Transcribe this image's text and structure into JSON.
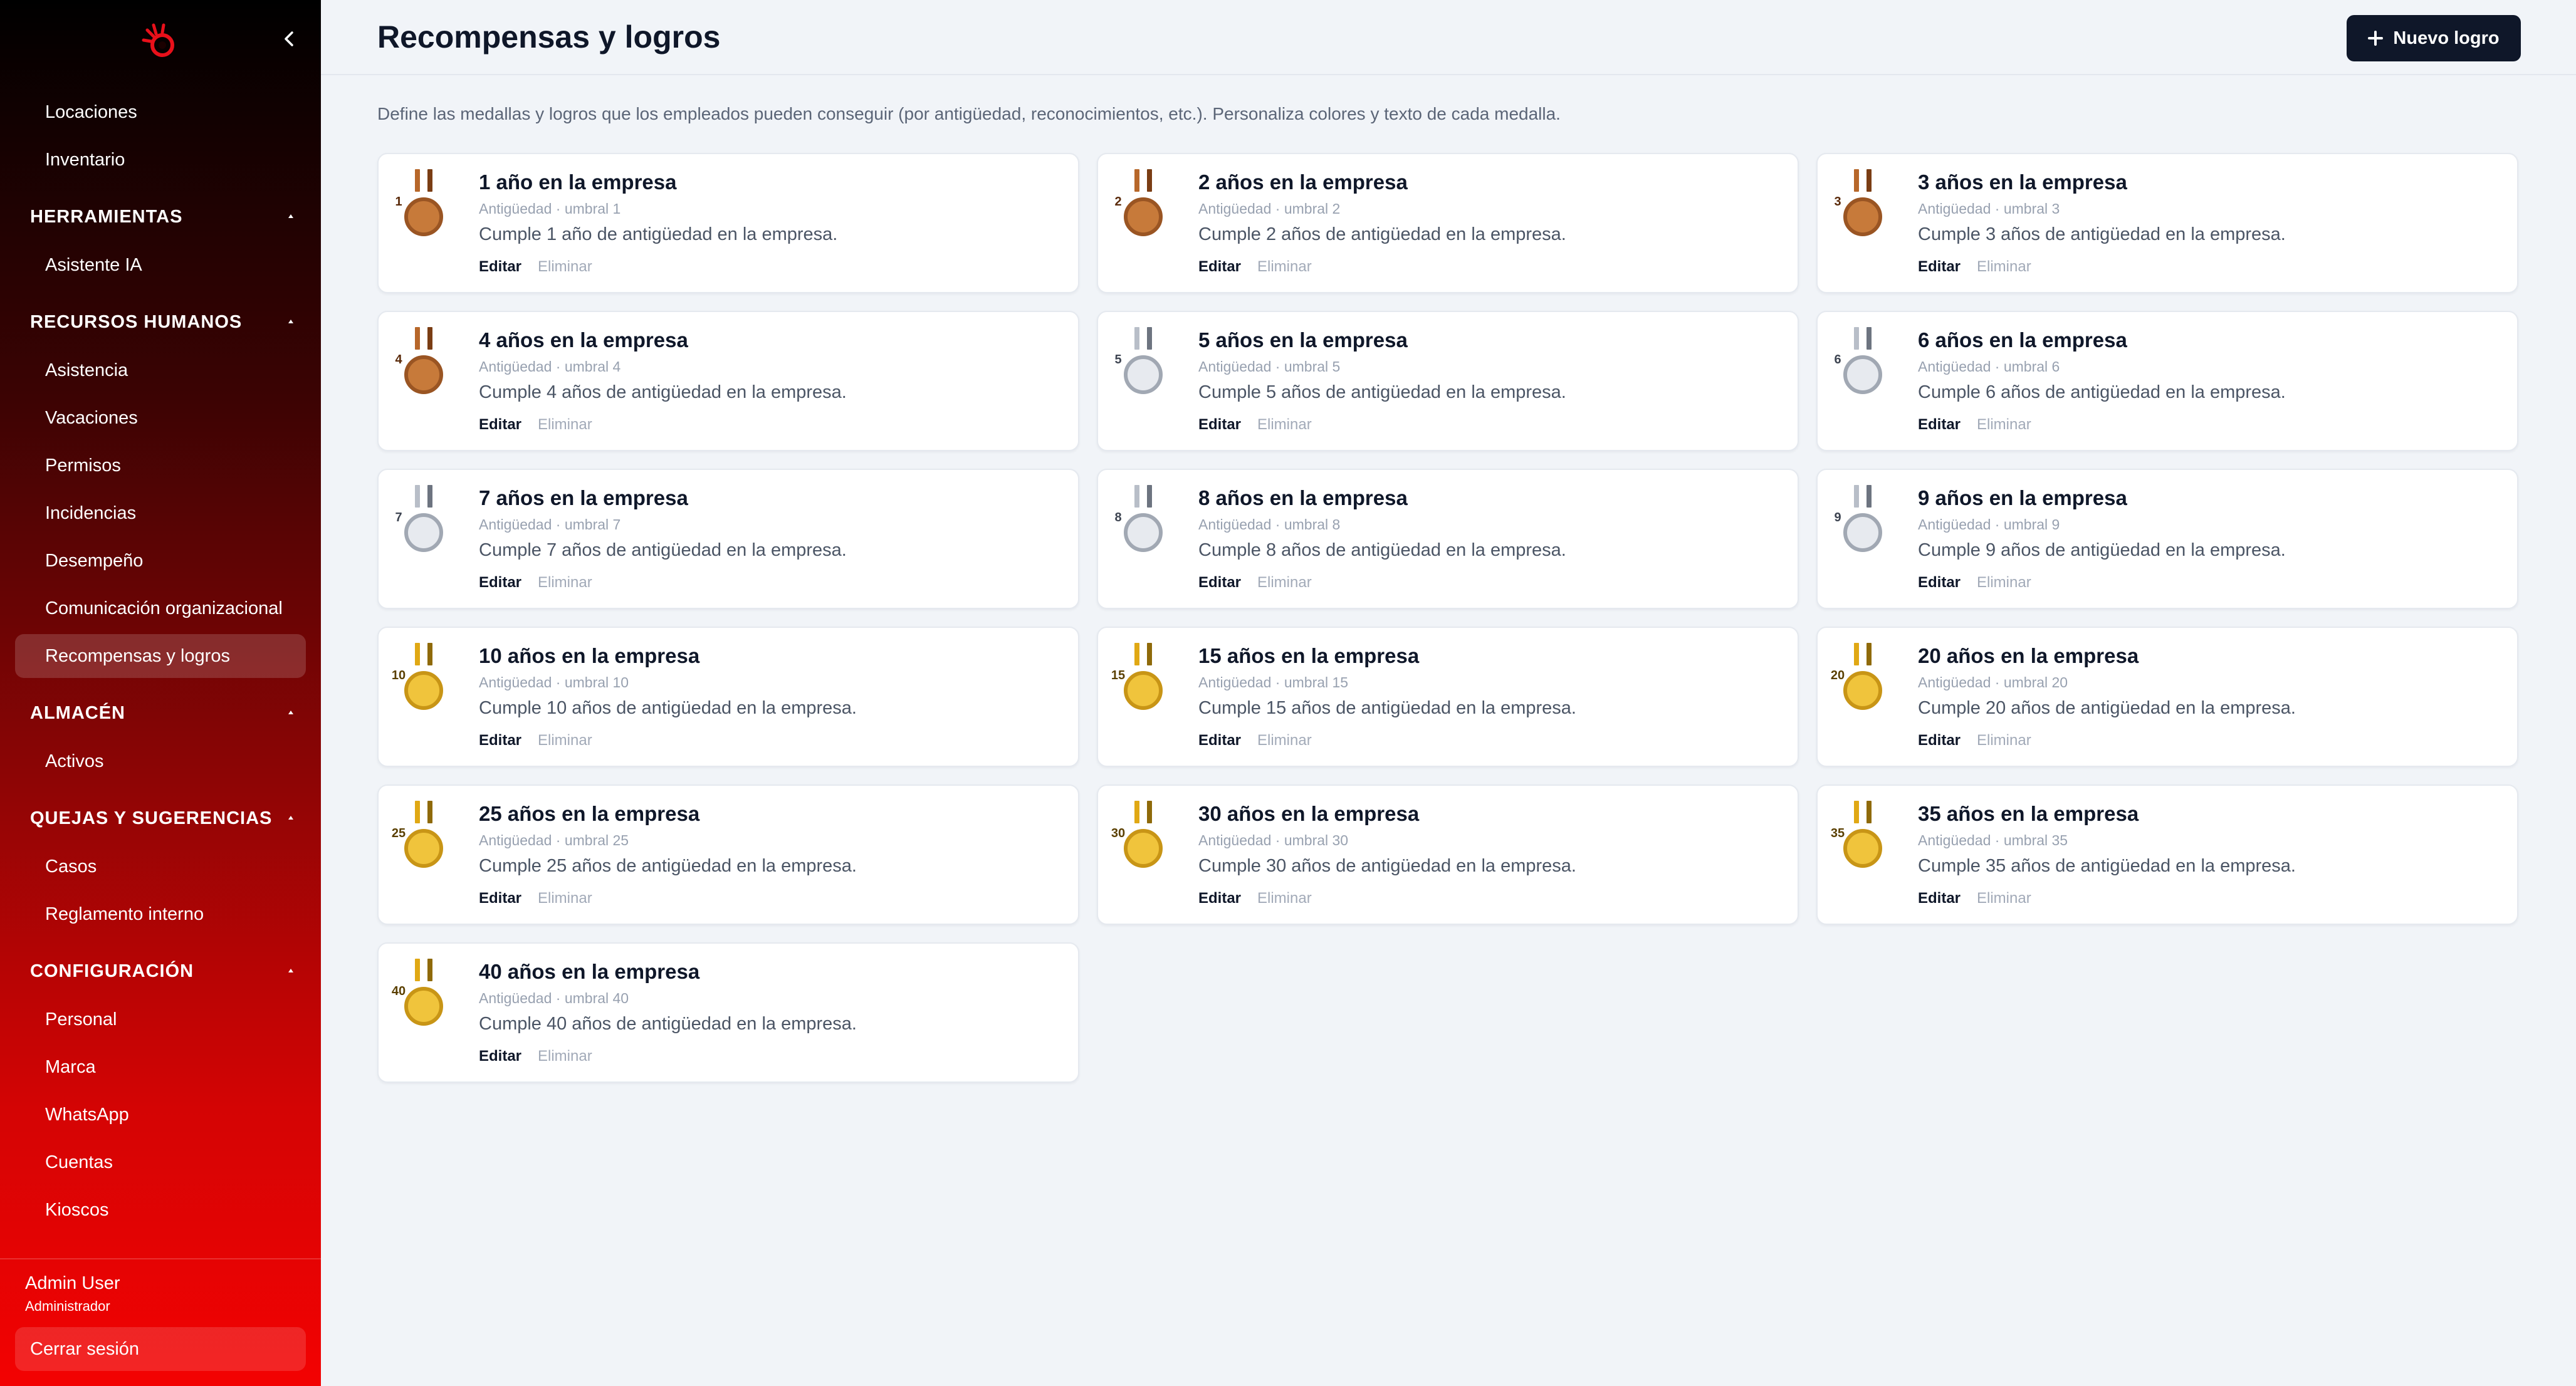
{
  "sidebar": {
    "items_top": [
      {
        "label": "Locaciones"
      },
      {
        "label": "Inventario"
      }
    ],
    "sections": [
      {
        "title": "HERRAMIENTAS",
        "items": [
          {
            "label": "Asistente IA"
          }
        ]
      },
      {
        "title": "RECURSOS HUMANOS",
        "items": [
          {
            "label": "Asistencia"
          },
          {
            "label": "Vacaciones"
          },
          {
            "label": "Permisos"
          },
          {
            "label": "Incidencias"
          },
          {
            "label": "Desempeño"
          },
          {
            "label": "Comunicación organizacional"
          },
          {
            "label": "Recompensas y logros"
          }
        ]
      },
      {
        "title": "ALMACÉN",
        "items": [
          {
            "label": "Activos"
          }
        ]
      },
      {
        "title": "QUEJAS Y SUGERENCIAS",
        "items": [
          {
            "label": "Casos"
          },
          {
            "label": "Reglamento interno"
          }
        ]
      },
      {
        "title": "CONFIGURACIÓN",
        "items": [
          {
            "label": "Personal"
          },
          {
            "label": "Marca"
          },
          {
            "label": "WhatsApp"
          },
          {
            "label": "Cuentas"
          },
          {
            "label": "Kioscos"
          }
        ]
      }
    ],
    "active_item": "Recompensas y logros",
    "user": {
      "name": "Admin User",
      "role": "Administrador"
    },
    "logout_label": "Cerrar sesión",
    "logo_icon": "brand-logo-icon",
    "collapse_icon": "chevron-left-icon"
  },
  "header": {
    "title": "Recompensas y logros",
    "new_button_label": "Nuevo logro",
    "new_button_icon": "plus-icon"
  },
  "subtitle": "Define las medallas y logros que los empleados pueden conseguir (por antigüedad, reconocimientos, etc.). Personaliza colores y texto de cada medalla.",
  "colors": {
    "primary": "#0f1729",
    "sidebar_top": "#000000",
    "sidebar_bottom": "#f30202",
    "bronze": "#c77a3a",
    "silver": "#d5d9df",
    "gold": "#f0c43c"
  },
  "achievements": [
    {
      "number": "1",
      "tier": "bronze",
      "title": "1 año en la empresa",
      "meta": "Antigüedad · umbral 1",
      "description": "Cumple 1 año de antigüedad en la empresa.",
      "edit": "Editar",
      "delete": "Eliminar"
    },
    {
      "number": "2",
      "tier": "bronze",
      "title": "2 años en la empresa",
      "meta": "Antigüedad · umbral 2",
      "description": "Cumple 2 años de antigüedad en la empresa.",
      "edit": "Editar",
      "delete": "Eliminar"
    },
    {
      "number": "3",
      "tier": "bronze",
      "title": "3 años en la empresa",
      "meta": "Antigüedad · umbral 3",
      "description": "Cumple 3 años de antigüedad en la empresa.",
      "edit": "Editar",
      "delete": "Eliminar"
    },
    {
      "number": "4",
      "tier": "bronze",
      "title": "4 años en la empresa",
      "meta": "Antigüedad · umbral 4",
      "description": "Cumple 4 años de antigüedad en la empresa.",
      "edit": "Editar",
      "delete": "Eliminar"
    },
    {
      "number": "5",
      "tier": "silver",
      "title": "5 años en la empresa",
      "meta": "Antigüedad · umbral 5",
      "description": "Cumple 5 años de antigüedad en la empresa.",
      "edit": "Editar",
      "delete": "Eliminar"
    },
    {
      "number": "6",
      "tier": "silver",
      "title": "6 años en la empresa",
      "meta": "Antigüedad · umbral 6",
      "description": "Cumple 6 años de antigüedad en la empresa.",
      "edit": "Editar",
      "delete": "Eliminar"
    },
    {
      "number": "7",
      "tier": "silver",
      "title": "7 años en la empresa",
      "meta": "Antigüedad · umbral 7",
      "description": "Cumple 7 años de antigüedad en la empresa.",
      "edit": "Editar",
      "delete": "Eliminar"
    },
    {
      "number": "8",
      "tier": "silver",
      "title": "8 años en la empresa",
      "meta": "Antigüedad · umbral 8",
      "description": "Cumple 8 años de antigüedad en la empresa.",
      "edit": "Editar",
      "delete": "Eliminar"
    },
    {
      "number": "9",
      "tier": "silver",
      "title": "9 años en la empresa",
      "meta": "Antigüedad · umbral 9",
      "description": "Cumple 9 años de antigüedad en la empresa.",
      "edit": "Editar",
      "delete": "Eliminar"
    },
    {
      "number": "10",
      "tier": "gold",
      "title": "10 años en la empresa",
      "meta": "Antigüedad · umbral 10",
      "description": "Cumple 10 años de antigüedad en la empresa.",
      "edit": "Editar",
      "delete": "Eliminar"
    },
    {
      "number": "15",
      "tier": "gold",
      "title": "15 años en la empresa",
      "meta": "Antigüedad · umbral 15",
      "description": "Cumple 15 años de antigüedad en la empresa.",
      "edit": "Editar",
      "delete": "Eliminar"
    },
    {
      "number": "20",
      "tier": "gold",
      "title": "20 años en la empresa",
      "meta": "Antigüedad · umbral 20",
      "description": "Cumple 20 años de antigüedad en la empresa.",
      "edit": "Editar",
      "delete": "Eliminar"
    },
    {
      "number": "25",
      "tier": "gold",
      "title": "25 años en la empresa",
      "meta": "Antigüedad · umbral 25",
      "description": "Cumple 25 años de antigüedad en la empresa.",
      "edit": "Editar",
      "delete": "Eliminar"
    },
    {
      "number": "30",
      "tier": "gold",
      "title": "30 años en la empresa",
      "meta": "Antigüedad · umbral 30",
      "description": "Cumple 30 años de antigüedad en la empresa.",
      "edit": "Editar",
      "delete": "Eliminar"
    },
    {
      "number": "35",
      "tier": "gold",
      "title": "35 años en la empresa",
      "meta": "Antigüedad · umbral 35",
      "description": "Cumple 35 años de antigüedad en la empresa.",
      "edit": "Editar",
      "delete": "Eliminar"
    },
    {
      "number": "40",
      "tier": "gold",
      "title": "40 años en la empresa",
      "meta": "Antigüedad · umbral 40",
      "description": "Cumple 40 años de antigüedad en la empresa.",
      "edit": "Editar",
      "delete": "Eliminar"
    }
  ]
}
